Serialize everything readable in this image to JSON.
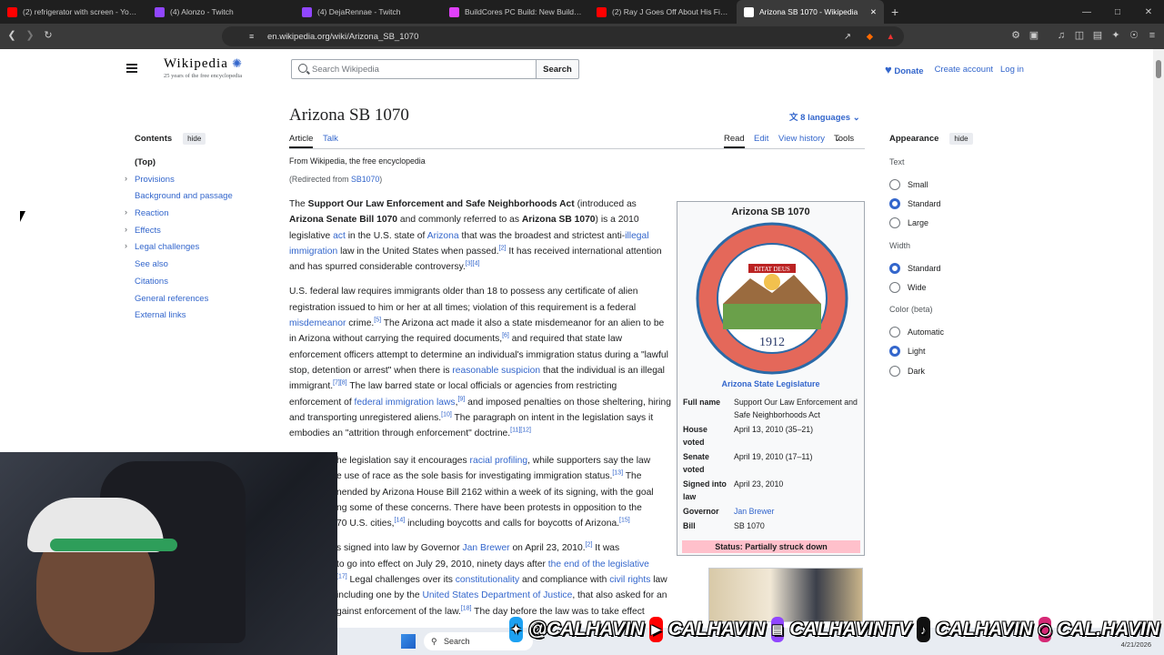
{
  "browser": {
    "tabs": [
      {
        "title": "(2) refrigerator with screen - YouTube",
        "color": "#ff0000"
      },
      {
        "title": "(4) Alonzo - Twitch",
        "color": "#9146ff"
      },
      {
        "title": "(4) DejaRennae - Twitch",
        "color": "#9146ff"
      },
      {
        "title": "BuildCores PC Build: New Build (Clon",
        "color": "#e040fb"
      },
      {
        "title": "(2) Ray J Goes Off About His Fight W",
        "color": "#ff0000"
      },
      {
        "title": "Arizona SB 1070 - Wikipedia",
        "color": "#ffffff"
      }
    ],
    "url": "en.wikipedia.org/wiki/Arizona_SB_1070"
  },
  "wiki": {
    "wordmark": "Wikipedia",
    "tagline": "25 years of the free encyclopedia",
    "search_placeholder": "Search Wikipedia",
    "search_button": "Search",
    "donate": "Donate",
    "create_account": "Create account",
    "login": "Log in"
  },
  "toc": {
    "title": "Contents",
    "hide": "hide",
    "items": [
      "(Top)",
      "Provisions",
      "Background and passage",
      "Reaction",
      "Effects",
      "Legal challenges",
      "See also",
      "Citations",
      "General references",
      "External links"
    ]
  },
  "article": {
    "title": "Arizona SB 1070",
    "languages": "8 languages",
    "tab_article": "Article",
    "tab_talk": "Talk",
    "tab_read": "Read",
    "tab_edit": "Edit",
    "tab_history": "View history",
    "tab_tools": "Tools",
    "from": "From Wikipedia, the free encyclopedia",
    "redirect_prefix": "(Redirected from ",
    "redirect_link": "SB1070",
    "redirect_suffix": ")"
  },
  "infobox": {
    "title": "Arizona SB 1070",
    "seal_top": "GREAT SEAL OF THE STATE OF ARIZONA",
    "seal_motto": "DITAT DEUS",
    "seal_year": "1912",
    "legislature": "Arizona State Legislature",
    "rows": [
      {
        "k": "Full name",
        "v": "Support Our Law Enforcement and Safe Neighborhoods Act"
      },
      {
        "k": "House voted",
        "v": "April 13, 2010 (35–21)"
      },
      {
        "k": "Senate voted",
        "v": "April 19, 2010 (17–11)"
      },
      {
        "k": "Signed into law",
        "v": "April 23, 2010"
      },
      {
        "k": "Governor",
        "v": "Jan Brewer"
      },
      {
        "k": "Bill",
        "v": "SB 1070"
      }
    ],
    "status": "Status: Partially struck down"
  },
  "appearance": {
    "title": "Appearance",
    "hide": "hide",
    "text_label": "Text",
    "text_opts": [
      "Small",
      "Standard",
      "Large"
    ],
    "text_sel": 1,
    "width_label": "Width",
    "width_opts": [
      "Standard",
      "Wide"
    ],
    "width_sel": 0,
    "color_label": "Color (beta)",
    "color_opts": [
      "Automatic",
      "Light",
      "Dark"
    ],
    "color_sel": 1
  },
  "overlay": {
    "handles": [
      "@CALHAVIN",
      "CALHAVIN",
      "CALHAVINTV",
      "CALHAVIN",
      "CAL.HAVIN"
    ],
    "taskbar_search": "Search",
    "date": "4/21/2026"
  }
}
